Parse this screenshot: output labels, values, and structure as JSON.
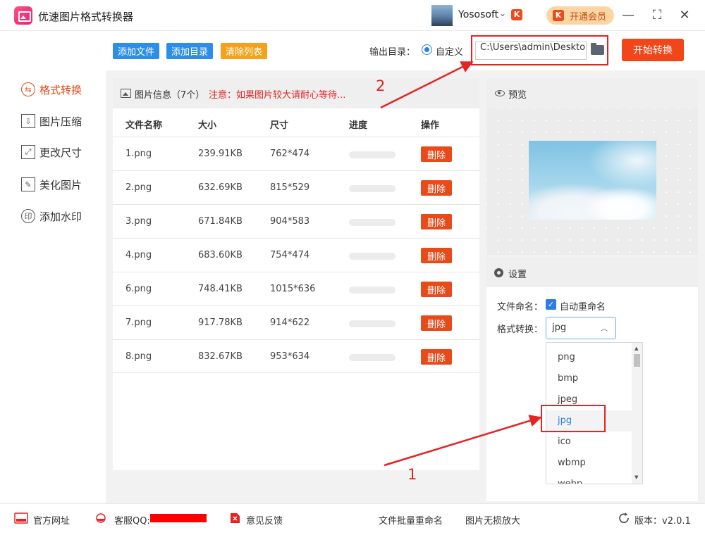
{
  "app": {
    "title": "优速图片格式转换器",
    "username": "Yososoft",
    "vip_label": "开通会员",
    "k_badge": "K"
  },
  "window": {
    "minimize": "—",
    "maximize": "⛶",
    "close": "✕"
  },
  "sidebar": {
    "items": [
      {
        "label": "格式转换",
        "icon": "⇆",
        "active": true
      },
      {
        "label": "图片压缩",
        "icon": "⇩"
      },
      {
        "label": "更改尺寸",
        "icon": "⤢"
      },
      {
        "label": "美化图片",
        "icon": "✎"
      },
      {
        "label": "添加水印",
        "icon": "印"
      }
    ]
  },
  "toolbar": {
    "add_file": "添加文件",
    "add_folder": "添加目录",
    "clear_list": "清除列表",
    "output_label": "输出目录：",
    "custom_label": "自定义",
    "output_path": "C:\\Users\\admin\\Deskto",
    "start_label": "开始转换",
    "colors": {
      "add": "#2d8ee8",
      "clear": "#f3a21a"
    }
  },
  "file_panel": {
    "title": "图片信息（7个）",
    "note": "注意：如果图片较大请耐心等待...",
    "columns": [
      "文件名称",
      "大小",
      "尺寸",
      "进度",
      "操作"
    ],
    "delete_label": "删除",
    "rows": [
      {
        "name": "1.png",
        "size": "239.91KB",
        "dims": "762*474",
        "progress": 0
      },
      {
        "name": "2.png",
        "size": "632.69KB",
        "dims": "815*529",
        "progress": 0
      },
      {
        "name": "3.png",
        "size": "671.84KB",
        "dims": "904*583",
        "progress": 0
      },
      {
        "name": "4.png",
        "size": "683.60KB",
        "dims": "754*474",
        "progress": 0
      },
      {
        "name": "6.png",
        "size": "748.41KB",
        "dims": "1015*636",
        "progress": 0
      },
      {
        "name": "7.png",
        "size": "917.78KB",
        "dims": "914*622",
        "progress": 0
      },
      {
        "name": "8.png",
        "size": "832.67KB",
        "dims": "953*634",
        "progress": 0
      }
    ]
  },
  "preview": {
    "title": "预览"
  },
  "settings": {
    "title": "设置",
    "naming_label": "文件命名：",
    "auto_rename": "自动重命名",
    "format_label": "格式转换：",
    "selected_format": "jpg",
    "options": [
      "png",
      "bmp",
      "jpeg",
      "jpg",
      "ico",
      "wbmp",
      "webp"
    ]
  },
  "annotations": {
    "one": "1",
    "two": "2"
  },
  "footer": {
    "website": "官方网址",
    "qq": "客服QQ:",
    "feedback": "意见反馈",
    "batch_rename": "文件批量重命名",
    "lossless": "图片无损放大",
    "version": "版本：v2.0.1"
  }
}
